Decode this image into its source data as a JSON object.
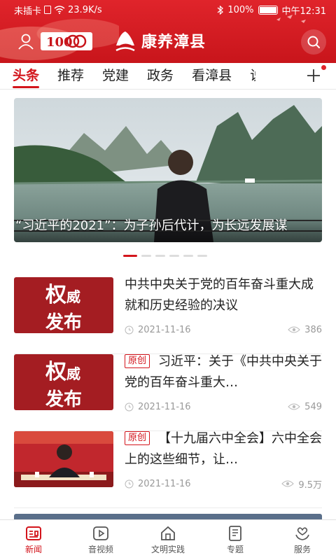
{
  "status_bar": {
    "sim": "未插卡",
    "speed": "23.9K/s",
    "battery": "100%",
    "time": "中午12:31"
  },
  "header": {
    "brand_title": "康养漳县",
    "accent_color": "#d3151c"
  },
  "tabs": [
    {
      "label": "头条",
      "active": true
    },
    {
      "label": "推荐",
      "active": false
    },
    {
      "label": "党建",
      "active": false
    },
    {
      "label": "政务",
      "active": false
    },
    {
      "label": "看漳县",
      "active": false
    },
    {
      "label": "说",
      "active": false
    }
  ],
  "banner": {
    "caption": "“习近平的2021”：为子孙后代计，为长远发展谋",
    "slides": 6,
    "active_slide": 0
  },
  "news": [
    {
      "thumb": {
        "quan": "权",
        "wei": "威",
        "fabu": "发布"
      },
      "original": false,
      "title": "中共中央关于党的百年奋斗重大成就和历史经验的决议",
      "date": "2021-11-16",
      "views": "386"
    },
    {
      "thumb": {
        "quan": "权",
        "wei": "威",
        "fabu": "发布"
      },
      "original": true,
      "tag": "原创",
      "title": "习近平：关于《中共中央关于党的百年奋斗重大…",
      "date": "2021-11-16",
      "views": "549"
    },
    {
      "thumb": {
        "type": "photo"
      },
      "original": true,
      "tag": "原创",
      "title": "【十九届六中全会】六中全会上的这些细节，让…",
      "date": "2021-11-16",
      "views": "9.5万"
    }
  ],
  "bottom_nav": [
    {
      "label": "新闻",
      "icon": "news-icon",
      "active": true
    },
    {
      "label": "音视频",
      "icon": "video-icon",
      "active": false
    },
    {
      "label": "文明实践",
      "icon": "house-icon",
      "active": false
    },
    {
      "label": "专题",
      "icon": "topic-icon",
      "active": false
    },
    {
      "label": "服务",
      "icon": "service-icon",
      "active": false
    }
  ]
}
